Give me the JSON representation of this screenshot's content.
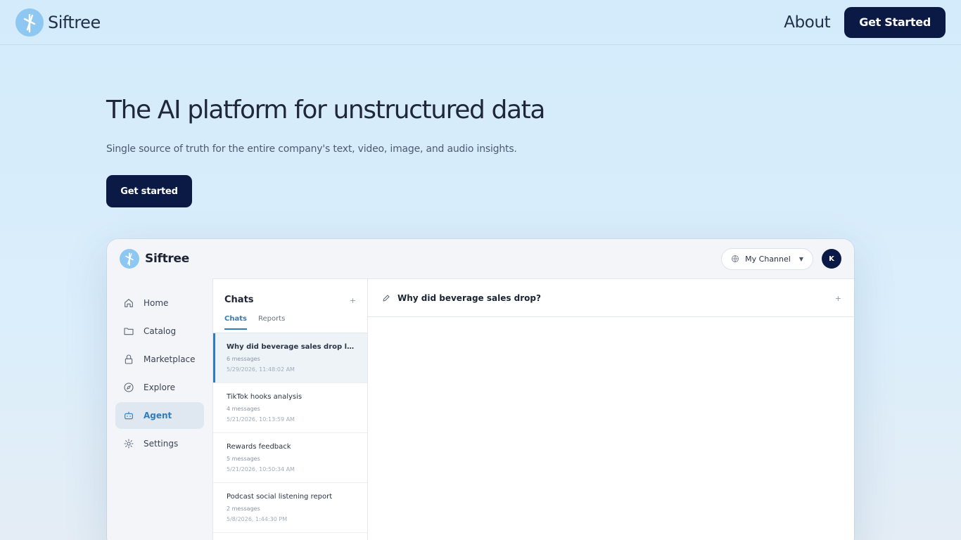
{
  "nav": {
    "brand": "Siftree",
    "about": "About",
    "cta": "Get Started"
  },
  "hero": {
    "title": "The AI platform for unstructured data",
    "subtitle": "Single source of truth for the entire company's text, video, image, and audio insights.",
    "cta": "Get started"
  },
  "app": {
    "brand": "Siftree",
    "channel": "My Channel",
    "avatar_initial": "K",
    "sidebar": [
      {
        "label": "Home",
        "icon": "home-icon"
      },
      {
        "label": "Catalog",
        "icon": "folder-icon"
      },
      {
        "label": "Marketplace",
        "icon": "lock-icon"
      },
      {
        "label": "Explore",
        "icon": "compass-icon"
      },
      {
        "label": "Agent",
        "icon": "robot-icon",
        "active": true
      },
      {
        "label": "Settings",
        "icon": "gear-icon"
      }
    ],
    "chats": {
      "title": "Chats",
      "plus": "+",
      "tabs": [
        "Chats",
        "Reports"
      ],
      "items": [
        {
          "title": "Why did beverage sales drop last quarter?",
          "messages": "6 messages",
          "time": "5/29/2026, 11:48:02 AM"
        },
        {
          "title": "TikTok hooks analysis",
          "messages": "4 messages",
          "time": "5/21/2026, 10:13:59 AM"
        },
        {
          "title": "Rewards feedback",
          "messages": "5 messages",
          "time": "5/21/2026, 10:50:34 AM"
        },
        {
          "title": "Podcast social listening report",
          "messages": "2 messages",
          "time": "5/8/2026, 1:44:30 PM"
        }
      ]
    },
    "conversation": {
      "title": "Why did beverage sales drop?",
      "plus": "+"
    }
  },
  "colors": {
    "accent": "#2f7dbd",
    "navy": "#0b1a45",
    "background": "#d3ebfb"
  }
}
